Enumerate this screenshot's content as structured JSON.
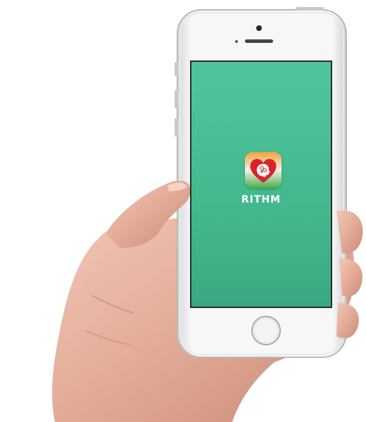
{
  "device": {
    "screen_color": "#4fc59f",
    "frame_color": "#f4f4f4"
  },
  "app": {
    "label": "RITHM",
    "icon": "heart-brain-icon",
    "icon_colors": {
      "heart": "#d9232b",
      "gradient_top": "#f0a23a",
      "gradient_bottom": "#3fae4a"
    }
  }
}
